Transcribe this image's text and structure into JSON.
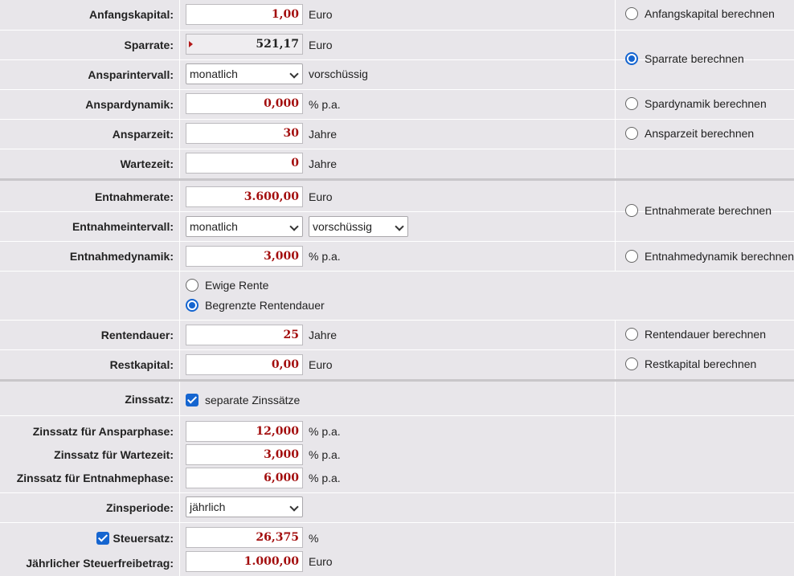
{
  "anfangskapital": {
    "label": "Anfangskapital:",
    "value": "1,00",
    "unit": "Euro",
    "radio": "Anfangskapital berechnen"
  },
  "sparrate": {
    "label": "Sparrate:",
    "value": "521,17",
    "unit": "Euro",
    "radio": "Sparrate berechnen"
  },
  "anspar_intervall": {
    "label": "Ansparintervall:",
    "value": "monatlich",
    "unit": "vorschüssig"
  },
  "anspar_dynamik": {
    "label": "Anspardynamik:",
    "value": "0,000",
    "unit": "% p.a.",
    "radio": "Spardynamik berechnen"
  },
  "anspar_zeit": {
    "label": "Ansparzeit:",
    "value": "30",
    "unit": "Jahre",
    "radio": "Ansparzeit berechnen"
  },
  "warte_zeit": {
    "label": "Wartezeit:",
    "value": "0",
    "unit": "Jahre"
  },
  "entnahme_rate": {
    "label": "Entnahmerate:",
    "value": "3.600,00",
    "unit": "Euro",
    "radio": "Entnahmerate berechnen"
  },
  "entnahme_intervall": {
    "label": "Entnahmeintervall:",
    "value": "monatlich",
    "timing": "vorschüssig"
  },
  "entnahme_dynamik": {
    "label": "Entnahmedynamik:",
    "value": "3,000",
    "unit": "% p.a.",
    "radio": "Entnahmedynamik berechnen"
  },
  "rente_option": {
    "ewig": "Ewige Rente",
    "begrenzt": "Begrenzte Rentendauer"
  },
  "renten_dauer": {
    "label": "Rentendauer:",
    "value": "25",
    "unit": "Jahre",
    "radio": "Rentendauer berechnen"
  },
  "rest_kapital": {
    "label": "Restkapital:",
    "value": "0,00",
    "unit": "Euro",
    "radio": "Restkapital berechnen"
  },
  "zinssatz": {
    "label": "Zinssatz:",
    "checkbox": "separate Zinssätze"
  },
  "zins_anspar": {
    "label": "Zinssatz für Ansparphase:",
    "value": "12,000",
    "unit": "% p.a."
  },
  "zins_warte": {
    "label": "Zinssatz für Wartezeit:",
    "value": "3,000",
    "unit": "% p.a."
  },
  "zins_entnahme": {
    "label": "Zinssatz für Entnahmephase:",
    "value": "6,000",
    "unit": "% p.a."
  },
  "zins_periode": {
    "label": "Zinsperiode:",
    "value": "jährlich"
  },
  "steuer_satz": {
    "label": "Steuersatz:",
    "value": "26,375",
    "unit": "%"
  },
  "steuer_freibetrag": {
    "label": "Jährlicher Steuerfreibetrag:",
    "value": "1.000,00",
    "unit": "Euro"
  }
}
